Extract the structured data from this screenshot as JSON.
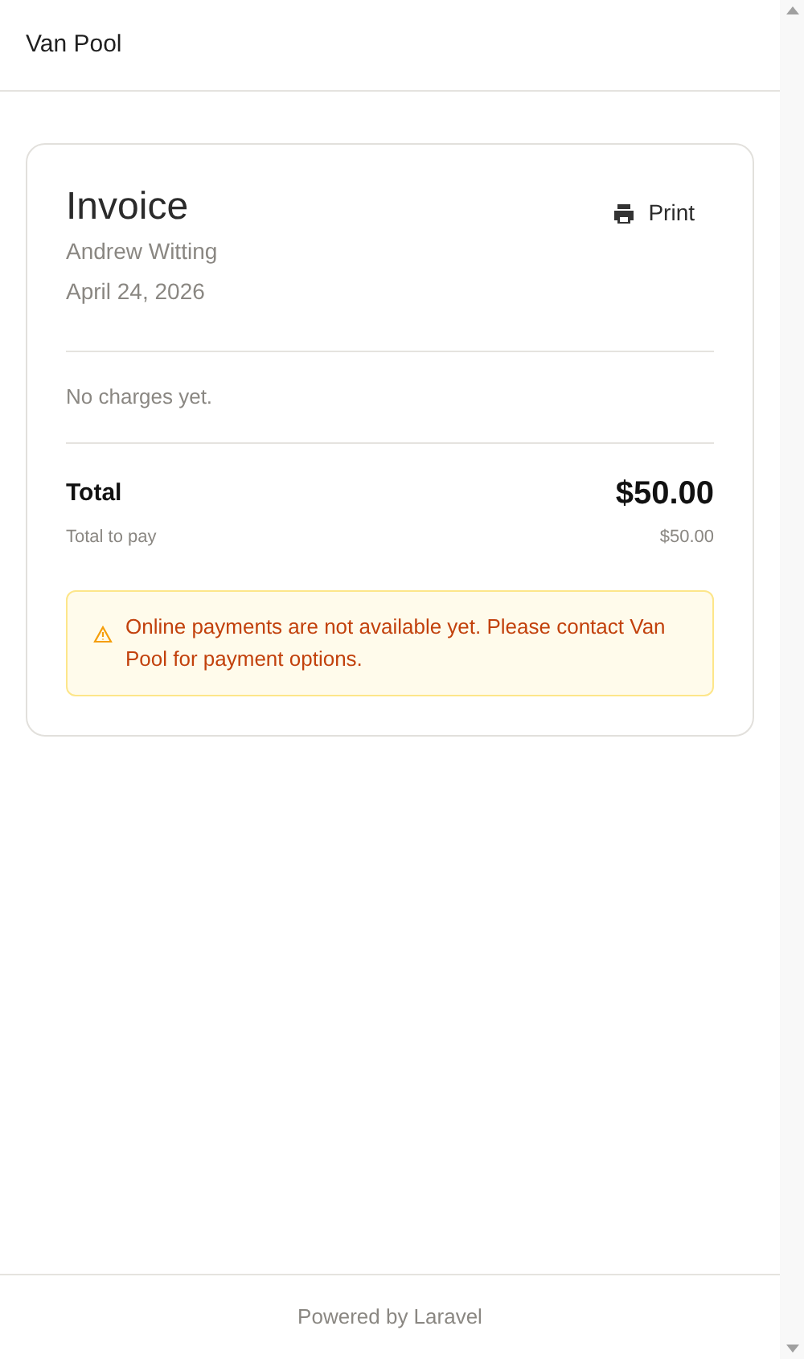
{
  "header": {
    "title": "Van Pool"
  },
  "invoice": {
    "title": "Invoice",
    "print_button": "Print",
    "customer": "Andrew Witting",
    "date": "April 24, 2026",
    "empty_message": "No charges yet.",
    "total_label": "Total",
    "total_amount": "$50.00",
    "subtotal_label": "Total to pay",
    "subtotal_amount": "$50.00"
  },
  "alert": {
    "message": "Online payments are not available yet. Please contact Van Pool for payment options."
  },
  "footer": {
    "text": "Powered by Laravel"
  }
}
